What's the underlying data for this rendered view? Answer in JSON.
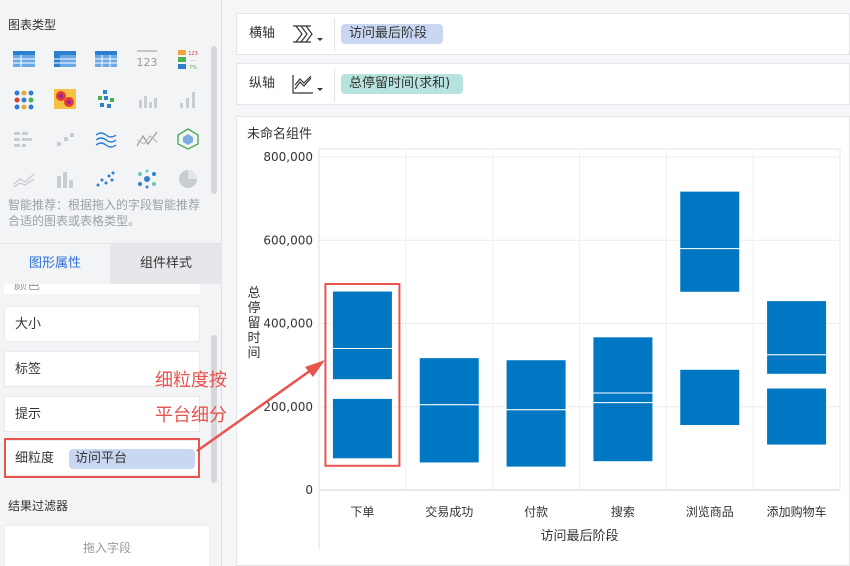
{
  "left_panel": {
    "chart_types_title": "图表类型",
    "smart_hint": "智能推荐：根据拖入的字段智能推荐合适的图表或表格类型。",
    "tabs": [
      {
        "label": "图形属性",
        "active": true
      },
      {
        "label": "组件样式",
        "active": false
      }
    ],
    "properties": [
      {
        "label": "大小"
      },
      {
        "label": "标签"
      },
      {
        "label": "提示"
      }
    ],
    "partial_property": "颜色",
    "granularity": {
      "label": "细粒度",
      "field": "访问平台"
    },
    "filter_title": "结果过滤器",
    "drop_field_placeholder": "拖入字段",
    "chart_type_icons": [
      "table-icon",
      "cross-table-icon",
      "detail-table-icon",
      "number-123-icon",
      "kpi-card-icon",
      "dot-matrix-icon",
      "heatmap-icon",
      "scatter-cluster-icon",
      "bar-small-icon",
      "bar-asc-icon",
      "dot-grid-icon",
      "scatter-small-icon",
      "wave-line-icon",
      "radar-line-icon",
      "radar-hex-icon",
      "area-line-icon",
      "bar-gray-icon",
      "dot-scatter-icon",
      "bubble-icon",
      "pie-icon"
    ]
  },
  "axes": {
    "x": {
      "label": "横轴",
      "field": "访问最后阶段"
    },
    "y": {
      "label": "纵轴",
      "field": "总停留时间(求和)"
    }
  },
  "widget": {
    "title": "未命名组件"
  },
  "annotation": {
    "line1": "细粒度按",
    "line2": "平台细分"
  },
  "colors": {
    "bar": "#0077c2",
    "accent_red": "#e8534e",
    "active_tab": "#2f6fd6"
  },
  "chart_data": {
    "type": "bar",
    "title": "",
    "xlabel": "访问最后阶段",
    "ylabel": "总停留时间",
    "ylim": [
      0,
      800000
    ],
    "yticks": [
      0,
      200000,
      400000,
      600000,
      800000
    ],
    "ytick_labels": [
      "0",
      "200,000",
      "400,000",
      "600,000",
      "800,000"
    ],
    "grid": true,
    "categories": [
      "下单",
      "交易成功",
      "付款",
      "搜索",
      "浏览商品",
      "添加购物车"
    ],
    "segments": [
      [
        [
          75000,
          220000
        ],
        [
          265000,
          340000
        ],
        [
          340000,
          478000
        ]
      ],
      [
        [
          65000,
          205000
        ],
        [
          205000,
          318000
        ]
      ],
      [
        [
          55000,
          193000
        ],
        [
          193000,
          313000
        ]
      ],
      [
        [
          68000,
          210000
        ],
        [
          210000,
          233000
        ],
        [
          233000,
          368000
        ]
      ],
      [
        [
          155000,
          290000
        ],
        [
          475000,
          580000
        ],
        [
          580000,
          718000
        ]
      ],
      [
        [
          108000,
          245000
        ],
        [
          278000,
          325000
        ],
        [
          325000,
          455000
        ]
      ]
    ],
    "highlighted_category": "下单"
  }
}
